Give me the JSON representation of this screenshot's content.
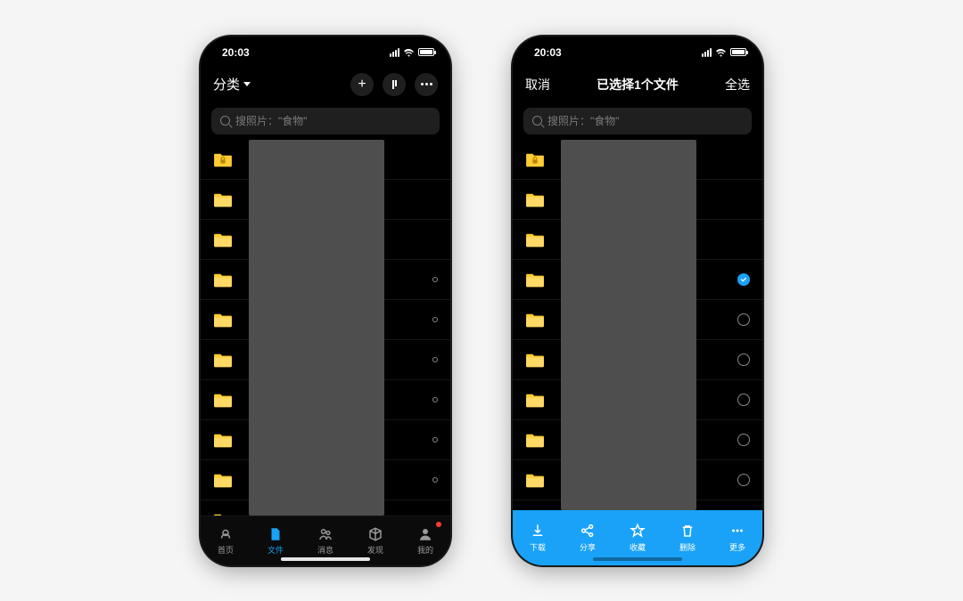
{
  "status": {
    "time": "20:03"
  },
  "left_screen": {
    "header": {
      "category_label": "分类"
    },
    "search": {
      "placeholder": "搜照片：\"食物\""
    },
    "folders": [
      {
        "kind": "locked"
      },
      {
        "kind": "folder"
      },
      {
        "kind": "folder"
      },
      {
        "kind": "folder",
        "marker": "small"
      },
      {
        "kind": "folder",
        "marker": "small"
      },
      {
        "kind": "folder",
        "marker": "small"
      },
      {
        "kind": "folder",
        "marker": "small"
      },
      {
        "kind": "folder",
        "marker": "small"
      },
      {
        "kind": "folder",
        "marker": "small"
      },
      {
        "kind": "folder"
      }
    ],
    "tabs": [
      {
        "label": "首页"
      },
      {
        "label": "文件"
      },
      {
        "label": "消息"
      },
      {
        "label": "发现"
      },
      {
        "label": "我的"
      }
    ]
  },
  "right_screen": {
    "header": {
      "cancel": "取消",
      "title": "已选择1个文件",
      "select_all": "全选"
    },
    "search": {
      "placeholder": "搜照片：\"食物\""
    },
    "folders": [
      {
        "kind": "locked"
      },
      {
        "kind": "folder"
      },
      {
        "kind": "folder"
      },
      {
        "kind": "folder",
        "radio": "checked"
      },
      {
        "kind": "folder",
        "radio": "empty"
      },
      {
        "kind": "folder",
        "radio": "empty"
      },
      {
        "kind": "folder",
        "radio": "empty"
      },
      {
        "kind": "folder",
        "radio": "empty"
      },
      {
        "kind": "folder",
        "radio": "empty"
      },
      {
        "kind": "folder"
      }
    ],
    "actions": [
      {
        "label": "下载"
      },
      {
        "label": "分享"
      },
      {
        "label": "收藏"
      },
      {
        "label": "删除"
      },
      {
        "label": "更多"
      }
    ]
  }
}
